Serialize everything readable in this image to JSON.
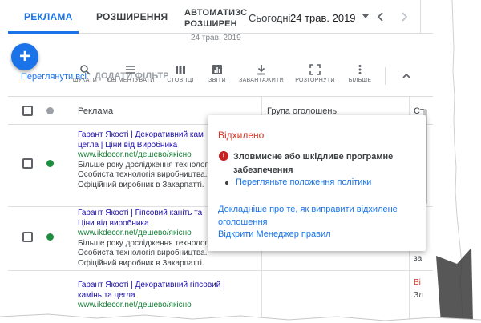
{
  "tabs": [
    {
      "label": "РЕКЛАМА",
      "active": true
    },
    {
      "label": "РОЗШИРЕННЯ",
      "active": false
    },
    {
      "label_lines": [
        "АВТОМАТИЗС",
        "РОЗШИРЕН"
      ],
      "active": false
    }
  ],
  "date_range": {
    "label": "Сьогодні",
    "value": "24 трав. 2019",
    "sub": "24 трав. 2019"
  },
  "toolbar": {
    "overview_link": "Переглянути всі",
    "add_filter": "ДОДАТИ ФІЛЬТР",
    "items": [
      {
        "label": "ШУКАТИ",
        "icon": "search-icon"
      },
      {
        "label": "СЕГМЕНТУВАТИ",
        "icon": "segment-icon"
      },
      {
        "label": "СТОВПЦІ",
        "icon": "columns-icon"
      },
      {
        "label": "ЗВІТИ",
        "icon": "reports-icon"
      },
      {
        "label": "ЗАВАНТАЖИТИ",
        "icon": "download-icon"
      },
      {
        "label": "РОЗГОРНУТИ",
        "icon": "expand-icon"
      },
      {
        "label": "БІЛЬШЕ",
        "icon": "more-icon"
      }
    ]
  },
  "table": {
    "headers": {
      "ad": "Реклама",
      "group": "Група оголошень",
      "status_partial": "Ст"
    },
    "rows": [
      {
        "title_lines": [
          "Гарант Якості | Декоративний кам",
          "цегла | Ціни від Виробника"
        ],
        "url": "www.ikdecor.net/дешево/якісно",
        "desc_lines": [
          "Більше року дослідження технологі",
          "Особиста технологія виробництва.",
          "Офіційний виробник в Закарпатті."
        ],
        "status_dot": "#1e8e3e"
      },
      {
        "title_lines": [
          "Гарант Якості | Гіпсовий каніть та",
          "Ціни від виробника"
        ],
        "url": "www.ikdecor.net/дешево/якісно",
        "desc_lines": [
          "Більше року дослідження технологі",
          "Особиста технологія виробництва.",
          "Офіційний виробник в Закарпатті."
        ],
        "status_dot": "#1e8e3e",
        "right_text": "за"
      },
      {
        "title_lines": [
          "Гарант Якості | Декоративний гіпсовий |",
          "камінь та цегла"
        ],
        "url": "www.ikdecor.net/дешево/якісно",
        "desc_lines": [],
        "status_dot": "",
        "right_lines": [
          "Ві",
          "Зл"
        ]
      }
    ]
  },
  "popup": {
    "title": "Відхилено",
    "error_text": "Зловмисне або шкідливе програмне забезпечення",
    "policy_link": "Перегляньте положення політики",
    "fix_link": "Докладніше про те, як виправити відхилене оголошення",
    "rules_link": "Відкрити Менеджер правил"
  },
  "colors": {
    "accent": "#1a73e8",
    "error": "#d93025",
    "status_active": "#1e8e3e",
    "ad_title": "#1a0dab",
    "ad_url": "#188038"
  }
}
